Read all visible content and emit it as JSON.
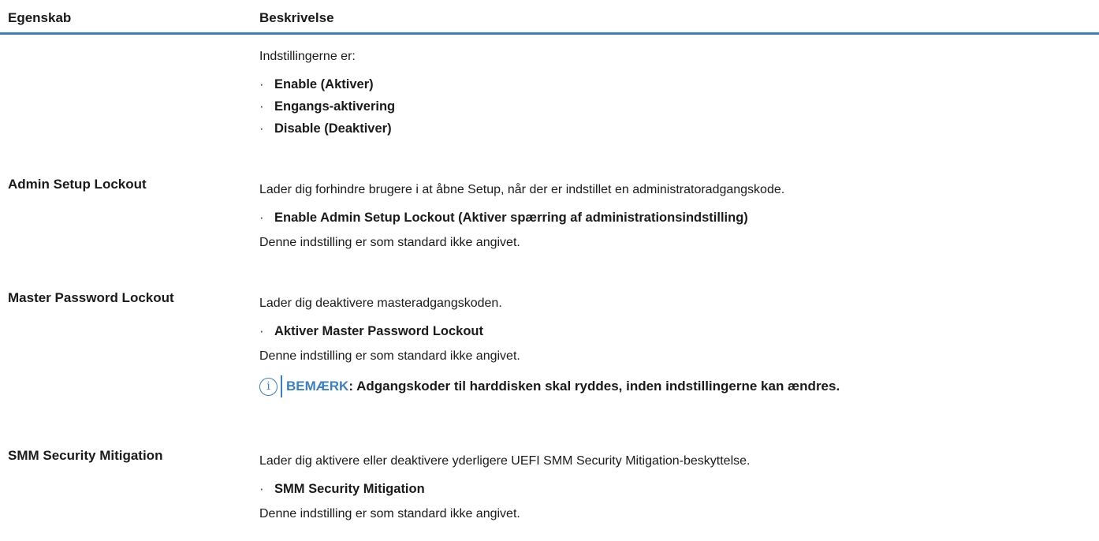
{
  "table": {
    "header": {
      "property": "Egenskab",
      "description": "Beskrivelse"
    },
    "rows": [
      {
        "property": "",
        "intro": "Indstillingerne er:",
        "bullets": [
          "Enable (Aktiver)",
          "Engangs-aktivering",
          "Disable (Deaktiver)"
        ]
      },
      {
        "property": "Admin Setup Lockout",
        "intro": "Lader dig forhindre brugere i at åbne Setup, når der er indstillet en administratoradgangskode.",
        "bullets": [
          "Enable Admin Setup Lockout (Aktiver spærring af administrationsindstilling)"
        ],
        "footer": "Denne indstilling er som standard ikke angivet."
      },
      {
        "property": "Master Password Lockout",
        "intro": "Lader dig deaktivere masteradgangskoden.",
        "bullets": [
          "Aktiver Master Password Lockout"
        ],
        "footer": "Denne indstilling er som standard ikke angivet.",
        "note": {
          "icon": "info-icon",
          "label": "BEMÆRK",
          "text": ": Adgangskoder til harddisken skal ryddes, inden indstillingerne kan ændres."
        }
      },
      {
        "property": "SMM Security Mitigation",
        "intro": "Lader dig aktivere eller deaktivere yderligere UEFI SMM Security Mitigation-beskyttelse.",
        "bullets": [
          "SMM Security Mitigation"
        ],
        "footer": "Denne indstilling er som standard ikke angivet."
      }
    ]
  },
  "colors": {
    "accent": "#3a7fc1",
    "text": "#1a1a1a"
  },
  "bullet_glyph": "·"
}
